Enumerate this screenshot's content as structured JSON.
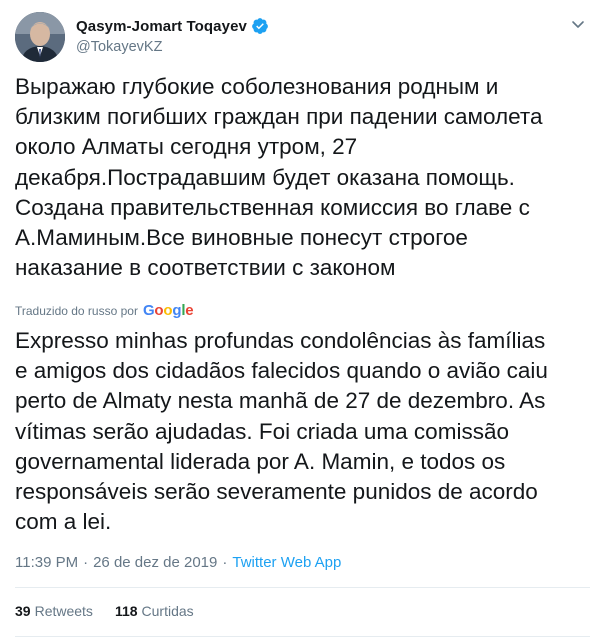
{
  "author": {
    "display_name": "Qasym-Jomart Toqayev",
    "handle": "@TokayevKZ",
    "verified": true
  },
  "tweet": {
    "original_text": "Выражаю глубокие соболезнования родным и\nблизким погибших граждан при падении самолета\nоколо Алматы сегодня утром, 27\nдекабря.Пострадавшим будет оказана помощь.\nСоздана правительственная комиссия во главе с\nА.Маминым.Все виновные понесут строгое\nнаказание в соответствии с законом",
    "translated_by_label": "Traduzido do russo por",
    "translator_brand": "Google",
    "translation_text": "Expresso minhas profundas condolências às famílias\ne amigos dos cidadãos falecidos quando o avião caiu\nperto de Almaty nesta manhã de 27 de dezembro. As\nvítimas serão ajudadas. Foi criada uma comissão\ngovernamental liderada por A. Mamin, e todos os\nresponsáveis serão severamente punidos de acordo\ncom a lei.",
    "time": "11:39 PM",
    "separator": "·",
    "date": "26 de dez de 2019",
    "source": "Twitter Web App"
  },
  "stats": {
    "retweets_count": "39",
    "retweets_label": "Retweets",
    "likes_count": "118",
    "likes_label": "Curtidas"
  },
  "colors": {
    "text": "#14171a",
    "secondary": "#657786",
    "link": "#1da1f2",
    "divider": "#e6ecf0",
    "google_blue": "#4285f4",
    "google_red": "#ea4335",
    "google_yellow": "#fbbc05",
    "google_green": "#34a853"
  },
  "icons": {
    "verified": "verified-badge-icon",
    "menu": "chevron-down-icon"
  }
}
